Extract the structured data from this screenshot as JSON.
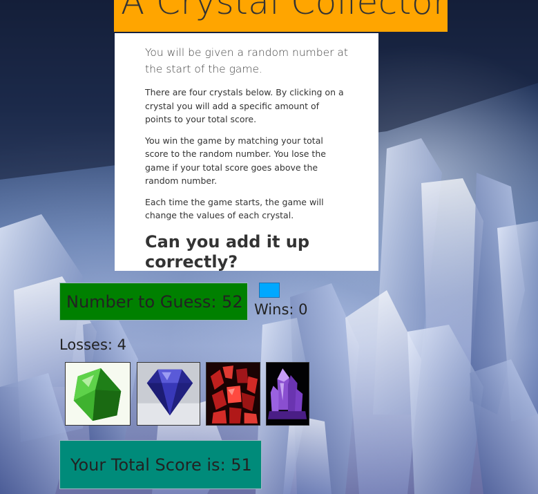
{
  "header": {
    "title": "A Crystal Collector"
  },
  "instructions": {
    "lead": "You will be given a random number at the start of the game.",
    "paragraph_1": "There are four crystals below. By clicking on a crystal you will add a specific amount of points to your total score.",
    "paragraph_2": "You win the game by matching your total score to the random number. You lose the game if your total score goes above the random number.",
    "paragraph_3": "Each time the game starts, the game will change the values of each crystal.",
    "question": "Can you add it up correctly?"
  },
  "game": {
    "number_to_guess_text": "Number to Guess: 52",
    "wins_text": "Wins: 0",
    "losses_text": "Losses: 4",
    "total_score_text": "Your Total Score is: 51"
  },
  "crystals": [
    {
      "name": "green-crystal",
      "color": "#2e9e22"
    },
    {
      "name": "blue-crystal",
      "color": "#2a2ab0"
    },
    {
      "name": "red-crystal",
      "color": "#c0201e"
    },
    {
      "name": "purple-crystal",
      "color": "#8a4fd0"
    }
  ],
  "colors": {
    "title_bg": "#ffa500",
    "number_box_bg": "#008000",
    "score_box_bg": "#008b7a",
    "blue_square": "#00a8ff"
  }
}
